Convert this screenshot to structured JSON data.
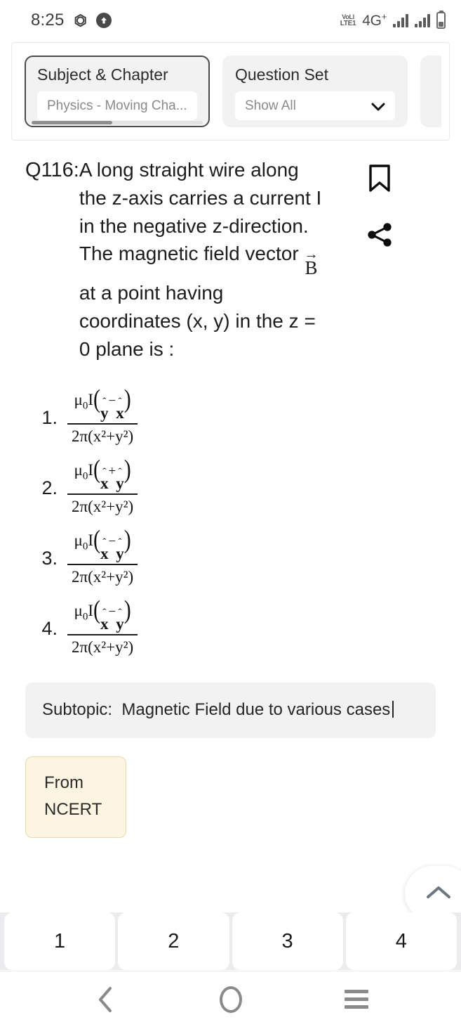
{
  "status_bar": {
    "time": "8:25",
    "left_icons": [
      "m-icon",
      "upload-circle-icon"
    ],
    "network_label": "4G",
    "network_sup": "+",
    "volte_top": "VoLl",
    "volte_bottom": "LTE1",
    "right_icons": [
      "signal-bars-icon",
      "signal-bars-icon",
      "battery-icon"
    ]
  },
  "filters": {
    "cards": [
      {
        "title": "Subject & Chapter",
        "value": "Physics - Moving Cha...",
        "has_chevron": false,
        "active": true
      },
      {
        "title": "Question Set",
        "value": "Show All",
        "has_chevron": true,
        "active": false
      }
    ]
  },
  "question": {
    "number_label": "Q116:",
    "line1": "A long straight wire along",
    "line2": "the z-axis carries a current I",
    "line3": "in the negative z-direction.",
    "line4_pre": "The magnetic field vector ",
    "vector_symbol": "B",
    "vector_arrow": "→",
    "line5": " at a point having",
    "line6": "coordinates (x, y) in the z =",
    "line7": "0 plane is :",
    "bookmark_icon": "bookmark-icon",
    "share_icon": "share-icon"
  },
  "options": [
    {
      "number": "1.",
      "numerator": {
        "mu": "μ",
        "mu_sub": "0",
        "I": "I",
        "open": "(",
        "t1_base": "y",
        "t1_hat": "ı̂",
        "op": "−",
        "t2_base": "x",
        "t2_hat": "ȷ̂",
        "close": ")"
      },
      "denominator": "2π(x²+y²)",
      "plain": "μ₀I(yî − xĵ) / 2π(x²+y²)"
    },
    {
      "number": "2.",
      "numerator": {
        "mu": "μ",
        "mu_sub": "0",
        "I": "I",
        "open": "(",
        "t1_base": "x",
        "t1_hat": "ı̂",
        "op": "+",
        "t2_base": "y",
        "t2_hat": "ȷ̂",
        "close": ")"
      },
      "denominator": "2π(x²+y²)",
      "plain": "μ₀I(xî + yĵ) / 2π(x²+y²)"
    },
    {
      "number": "3.",
      "numerator": {
        "mu": "μ",
        "mu_sub": "0",
        "I": "I",
        "open": "(",
        "t1_base": "x",
        "t1_hat": "ȷ̂",
        "op": "−",
        "t2_base": "y",
        "t2_hat": "ı̂",
        "close": ")"
      },
      "denominator": "2π(x²+y²)",
      "plain": "μ₀I(xĵ − yî) / 2π(x²+y²)"
    },
    {
      "number": "4.",
      "numerator": {
        "mu": "μ",
        "mu_sub": "0",
        "I": "I",
        "open": "(",
        "t1_base": "x",
        "t1_hat": "ı̂",
        "op": "−",
        "t2_base": "y",
        "t2_hat": "ȷ̂",
        "close": ")"
      },
      "denominator": "2π(x²+y²)",
      "plain": "μ₀I(xî − yĵ) / 2π(x²+y²)"
    }
  ],
  "subtopic": {
    "label": "Subtopic:",
    "value": "Magnetic Field due to various cases"
  },
  "ncert_badge": {
    "line1": "From",
    "line2": "NCERT"
  },
  "scroll_top_fab": {
    "icon": "chevron-up-icon"
  },
  "answer_buttons": [
    "1",
    "2",
    "3",
    "4"
  ],
  "nav_bar": {
    "back": "back-chevron-icon",
    "home": "home-circle-icon",
    "recents": "recents-menu-icon"
  },
  "colors": {
    "page_bg": "#ffffff",
    "card_bg": "#f2f2f3",
    "answerbar_bg": "#ececee",
    "ncert_bg": "#fdf5e2",
    "ncert_border": "#e8d9ae",
    "text": "#1d1d1d",
    "muted": "#8a8a8a"
  }
}
